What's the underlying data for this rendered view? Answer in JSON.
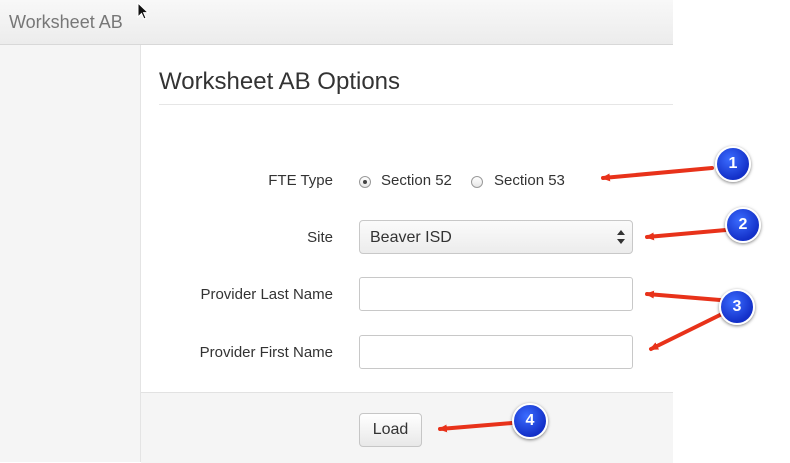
{
  "app": {
    "title": "Worksheet AB"
  },
  "page": {
    "title": "Worksheet AB Options"
  },
  "form": {
    "fte_type": {
      "label": "FTE Type",
      "options": [
        {
          "label": "Section 52",
          "selected": true
        },
        {
          "label": "Section 53",
          "selected": false
        }
      ]
    },
    "site": {
      "label": "Site",
      "value": "Beaver ISD"
    },
    "provider_last_name": {
      "label": "Provider Last Name",
      "value": ""
    },
    "provider_first_name": {
      "label": "Provider First Name",
      "value": ""
    },
    "load_label": "Load"
  },
  "annotations": {
    "badges": [
      "1",
      "2",
      "3",
      "4"
    ],
    "badge_color": "#1a3fe0",
    "arrow_color": "#e8321a"
  }
}
